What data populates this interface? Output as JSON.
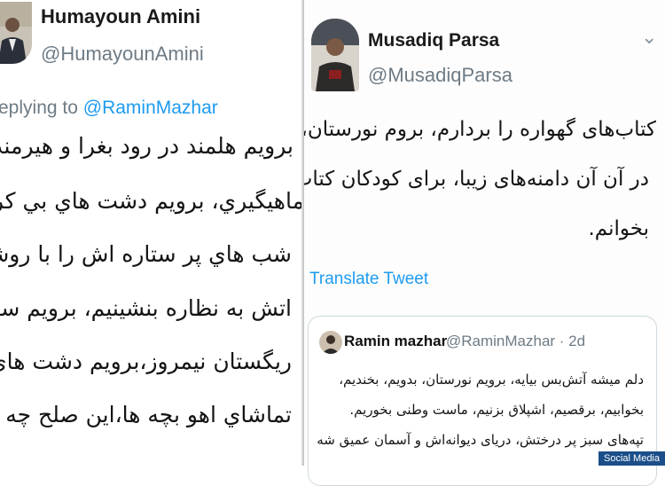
{
  "left_tweet": {
    "display_name": "Humayoun Amini",
    "handle": "@HumayounAmini",
    "replying_prefix": "eplying to",
    "replying_mention": "@RaminMazhar",
    "lines": [
      "برويم هلمند در رود بغرا و هيرمند",
      "ماهيگيري، برويم دشت هاي بي كران جنوب",
      "شب هاي پر ستاره اش را با روشن كردن",
      "اتش به نظاره بنشينيم، برويم سفاري در",
      "ريگستان نيمروز،برويم دشت هاي فراه به",
      "تماشاي اهو بچه ها،اين صلح چه صفاي"
    ],
    "avatar_icon": "user-photo"
  },
  "right_tweet": {
    "display_name": "Musadiq Parsa",
    "handle": "@MusadiqParsa",
    "menu_icon": "chevron-down-icon",
    "lines": [
      "کتاب‌های گهواره را بردارم، بروم نورستان، و",
      "در آن آن دامنه‌های زیبا، برای کودکان کتاب",
      "بخوانم."
    ],
    "translate_label": "Translate Tweet"
  },
  "quoted_tweet": {
    "display_name": "Ramin mazhar",
    "handle_time": "@RaminMazhar · 2d",
    "lines": [
      "دلم میشه آتش‌بس بیایه، برویم نورستان، بدویم، بخندیم،",
      "بخوابیم، برقصیم، اشپلاق بزنیم، ماست وطنی بخوریم.",
      "تپه‌های سبز پر درختش، دریای دیوانه‌اش و آسمان عمیق شه"
    ]
  },
  "watermark": "Social Media",
  "colors": {
    "link": "#1d9bf0",
    "secondary_text": "#6e7b85",
    "border": "#cfd9de"
  }
}
